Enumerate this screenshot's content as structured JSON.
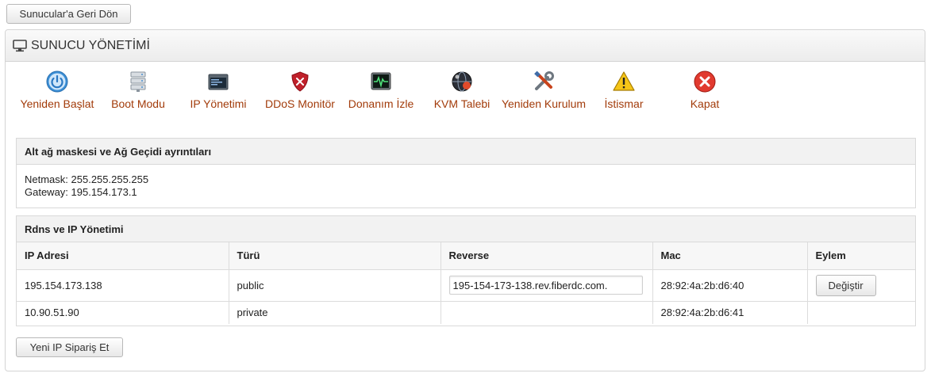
{
  "back_button": "Sunucular'a Geri Dön",
  "panel": {
    "title": "SUNUCU YÖNETİMİ",
    "title_icon": "monitor-icon"
  },
  "actions": [
    {
      "label": "Yeniden Başlat",
      "icon": "power-icon"
    },
    {
      "label": "Boot Modu",
      "icon": "server-stack-icon"
    },
    {
      "label": "IP Yönetimi",
      "icon": "window-icon"
    },
    {
      "label": "DDoS Monitör",
      "icon": "shield-icon"
    },
    {
      "label": "Donanım İzle",
      "icon": "pulse-monitor-icon"
    },
    {
      "label": "KVM Talebi",
      "icon": "globe-icon"
    },
    {
      "label": "Yeniden Kurulum",
      "icon": "tools-icon"
    },
    {
      "label": "İstismar",
      "icon": "warning-icon"
    },
    {
      "label": "Kapat",
      "icon": "close-circle-icon"
    }
  ],
  "network": {
    "title": "Alt ağ maskesi ve Ağ Geçidi ayrıntıları",
    "netmask_line": "Netmask: 255.255.255.255",
    "gateway_line": "Gateway: 195.154.173.1"
  },
  "rdns": {
    "title": "Rdns ve IP Yönetimi",
    "columns": [
      "IP Adresi",
      "Türü",
      "Reverse",
      "Mac",
      "Eylem"
    ],
    "rows": [
      {
        "ip": "195.154.173.138",
        "type": "public",
        "reverse": "195-154-173-138.rev.fiberdc.com.",
        "mac": "28:92:4a:2b:d6:40",
        "action": "Değiştir"
      },
      {
        "ip": "10.90.51.90",
        "type": "private",
        "reverse": "",
        "mac": "28:92:4a:2b:d6:41",
        "action": ""
      }
    ]
  },
  "new_ip_button": "Yeni IP Sipariş Et",
  "colors": {
    "action_label": "#a23b0a",
    "panel_header_bg": "#ececec",
    "box_header_bg": "#f2f2f2"
  }
}
